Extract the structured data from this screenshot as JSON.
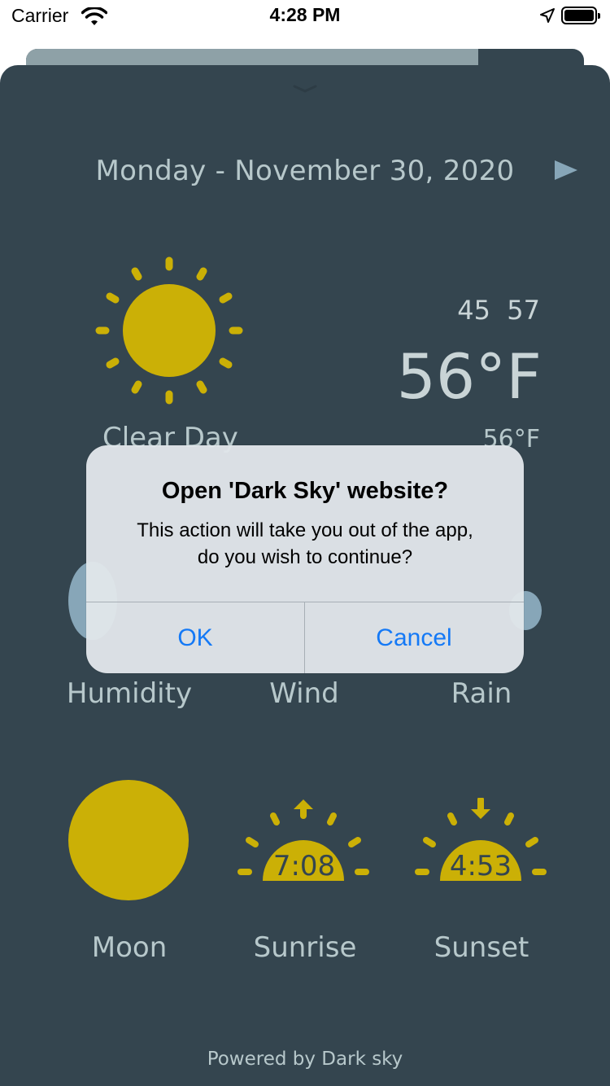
{
  "status_bar": {
    "carrier": "Carrier",
    "time": "4:28 PM"
  },
  "header": {
    "date": "Monday - November 30, 2020"
  },
  "current": {
    "low": "45",
    "high": "57",
    "temperature": "56°F",
    "condition": "Clear Day",
    "feels_like": "56°F"
  },
  "progress": {
    "fraction": 0.81
  },
  "metrics": {
    "humidity_label": "Humidity",
    "wind_label": "Wind",
    "rain_label": "Rain"
  },
  "astro": {
    "moon_label": "Moon",
    "sunrise_label": "Sunrise",
    "sunset_label": "Sunset",
    "sunrise_time": "7:08",
    "sunset_time": "4:53"
  },
  "footer": {
    "text": "Powered by Dark sky"
  },
  "alert": {
    "title": "Open 'Dark Sky' website?",
    "message_line1": "This action will take you out of the app,",
    "message_line2": "do you wish to continue?",
    "ok_label": "OK",
    "cancel_label": "Cancel"
  },
  "colors": {
    "background": "#34454f",
    "sun": "#cbb006",
    "text": "#b7c8cb",
    "accent": "#87a6b8",
    "ios_blue": "#1479f6"
  },
  "icons": [
    "wifi-icon",
    "location-arrow-icon",
    "battery-icon",
    "chevron-down-icon",
    "play-arrow-icon",
    "sun-icon",
    "moon-icon",
    "sunrise-icon",
    "sunset-icon"
  ]
}
